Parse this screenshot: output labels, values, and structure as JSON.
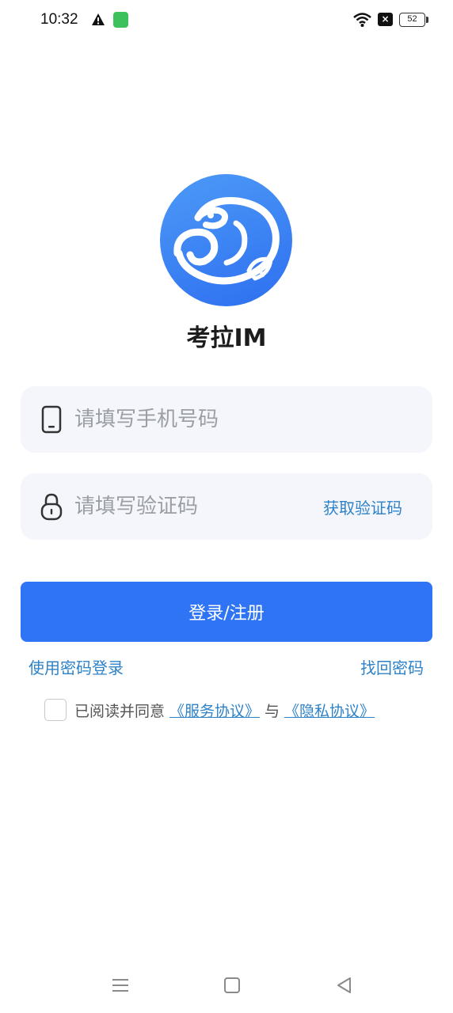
{
  "status_bar": {
    "time": "10:32",
    "battery": "52",
    "icons": [
      "warning-icon",
      "app-notification-icon",
      "wifi-icon",
      "no-signal-icon",
      "battery-icon"
    ]
  },
  "app": {
    "name": "考拉IM",
    "logo_icon": "koala-fish-logo",
    "accent_color": "#2e74f5",
    "link_color": "#2e82c8"
  },
  "login": {
    "phone_placeholder": "请填写手机号码",
    "phone_value": "",
    "code_placeholder": "请填写验证码",
    "code_value": "",
    "get_code_label": "获取验证码",
    "submit_label": "登录/注册",
    "password_login_label": "使用密码登录",
    "find_password_label": "找回密码"
  },
  "agreement": {
    "checked": false,
    "prefix": "已阅读并同意",
    "service_link": "《服务协议》",
    "conjunction": "与",
    "privacy_link": "《隐私协议》"
  },
  "nav_bar": {
    "icons": [
      "menu-icon",
      "home-icon",
      "back-icon"
    ]
  }
}
